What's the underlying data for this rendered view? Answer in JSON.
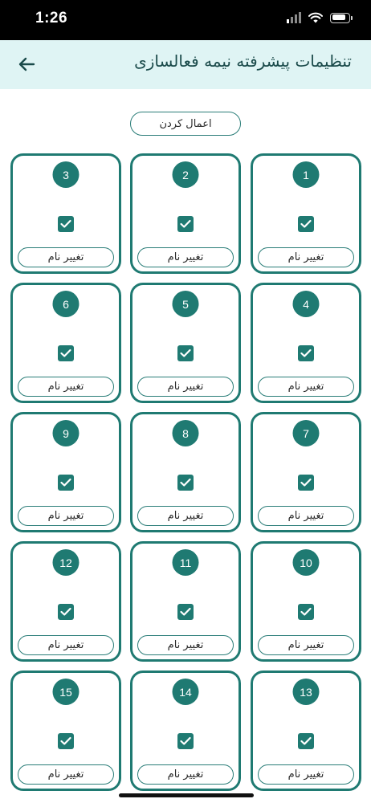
{
  "status_bar": {
    "time": "1:26",
    "icons": [
      "cellular-signal-icon",
      "wifi-icon",
      "battery-icon"
    ]
  },
  "header": {
    "title": "تنظیمات پیشرفته نیمه فعالسازی",
    "back_icon": "arrow-left-icon"
  },
  "apply_button_label": "اعمال کردن",
  "colors": {
    "accent": "#1f7a72",
    "header_background": "#dff4f4"
  },
  "cards": [
    {
      "number": "1",
      "checked": true,
      "rename_label": "تغییر نام"
    },
    {
      "number": "2",
      "checked": true,
      "rename_label": "تغییر نام"
    },
    {
      "number": "3",
      "checked": true,
      "rename_label": "تغییر نام"
    },
    {
      "number": "4",
      "checked": true,
      "rename_label": "تغییر نام"
    },
    {
      "number": "5",
      "checked": true,
      "rename_label": "تغییر نام"
    },
    {
      "number": "6",
      "checked": true,
      "rename_label": "تغییر نام"
    },
    {
      "number": "7",
      "checked": true,
      "rename_label": "تغییر نام"
    },
    {
      "number": "8",
      "checked": true,
      "rename_label": "تغییر نام"
    },
    {
      "number": "9",
      "checked": true,
      "rename_label": "تغییر نام"
    },
    {
      "number": "10",
      "checked": true,
      "rename_label": "تغییر نام"
    },
    {
      "number": "11",
      "checked": true,
      "rename_label": "تغییر نام"
    },
    {
      "number": "12",
      "checked": true,
      "rename_label": "تغییر نام"
    },
    {
      "number": "13",
      "checked": true,
      "rename_label": "تغییر نام"
    },
    {
      "number": "14",
      "checked": true,
      "rename_label": "تغییر نام"
    },
    {
      "number": "15",
      "checked": true,
      "rename_label": "تغییر نام"
    }
  ]
}
